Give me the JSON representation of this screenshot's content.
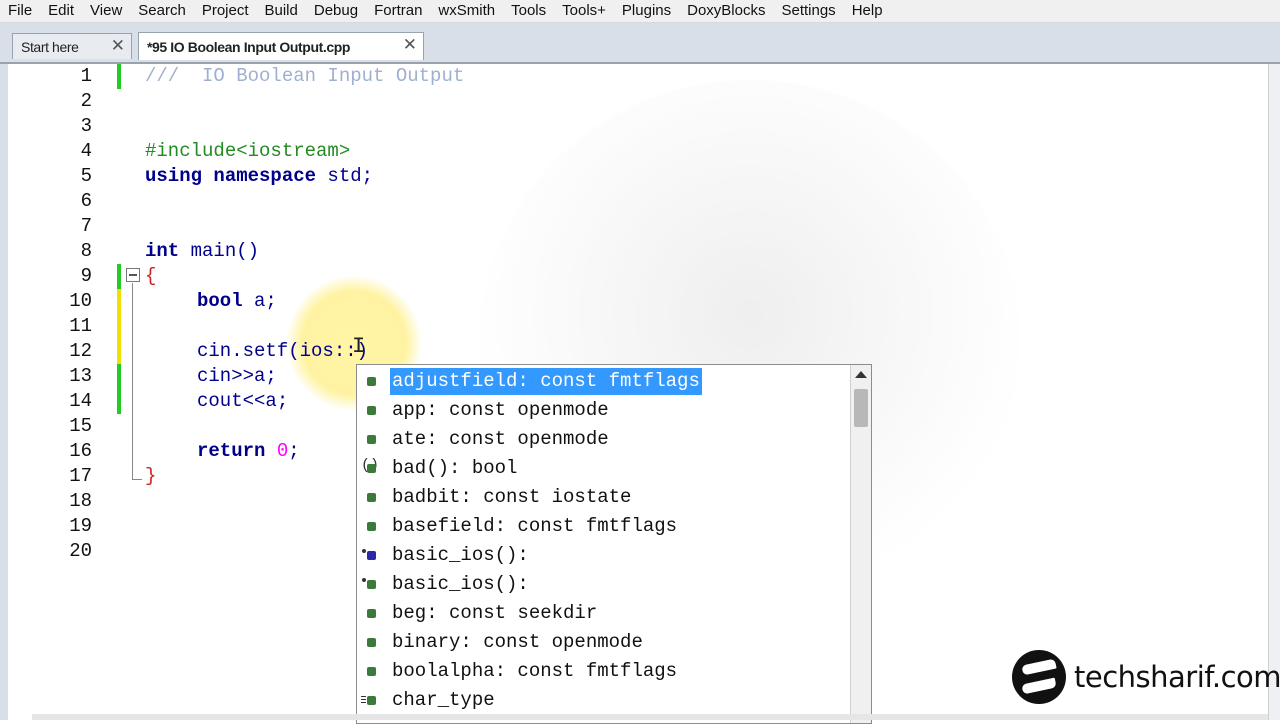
{
  "menu": [
    "File",
    "Edit",
    "View",
    "Search",
    "Project",
    "Build",
    "Debug",
    "Fortran",
    "wxSmith",
    "Tools",
    "Tools+",
    "Plugins",
    "DoxyBlocks",
    "Settings",
    "Help"
  ],
  "tabs": [
    {
      "label": "Start here",
      "active": false
    },
    {
      "label": "*95 IO Boolean Input Output.cpp",
      "active": true
    }
  ],
  "editor": {
    "line_numbers": [
      "1",
      "2",
      "3",
      "4",
      "5",
      "6",
      "7",
      "8",
      "9",
      "10",
      "11",
      "12",
      "13",
      "14",
      "15",
      "16",
      "17",
      "18",
      "19",
      "20"
    ],
    "lines": {
      "l1": "///  IO Boolean Input Output",
      "l4": "#include<iostream>",
      "l5_kw": "using namespace",
      "l5_rest": " std;",
      "l8_kw": "int",
      "l8_rest": " main()",
      "l9": "{",
      "l10_kw": "bool",
      "l10_rest": " a;",
      "l12": "cin.setf(ios::)",
      "l13": "cin>>a;",
      "l14": "cout<<a;",
      "l16_kw": "return",
      "l16_num": "0",
      "l17": "}"
    }
  },
  "autocomplete": {
    "items": [
      {
        "text": "adjustfield: const fmtflags",
        "icon": "member-icon",
        "selected": true
      },
      {
        "text": "app: const openmode",
        "icon": "member-icon"
      },
      {
        "text": "ate: const openmode",
        "icon": "member-icon"
      },
      {
        "text": "bad(): bool",
        "icon": "function-icon"
      },
      {
        "text": "badbit: const iostate",
        "icon": "member-icon"
      },
      {
        "text": "basefield: const fmtflags",
        "icon": "member-icon"
      },
      {
        "text": "basic_ios():",
        "icon": "constructor-icon-blue"
      },
      {
        "text": "basic_ios():",
        "icon": "constructor-icon-green"
      },
      {
        "text": "beg: const seekdir",
        "icon": "member-icon"
      },
      {
        "text": "binary: const openmode",
        "icon": "member-icon"
      },
      {
        "text": "boolalpha: const fmtflags",
        "icon": "member-icon"
      },
      {
        "text": "char_type",
        "icon": "typedef-icon"
      }
    ]
  },
  "brand": {
    "text": "techsharif.com"
  },
  "colors": {
    "selection": "#3399ff",
    "keyword": "#00008b",
    "preprocessor": "#228b22",
    "comment": "#a0b0d0",
    "number": "#ff00ff",
    "change_bar_saved": "#22cc22",
    "change_bar_unsaved": "#f0e000"
  }
}
